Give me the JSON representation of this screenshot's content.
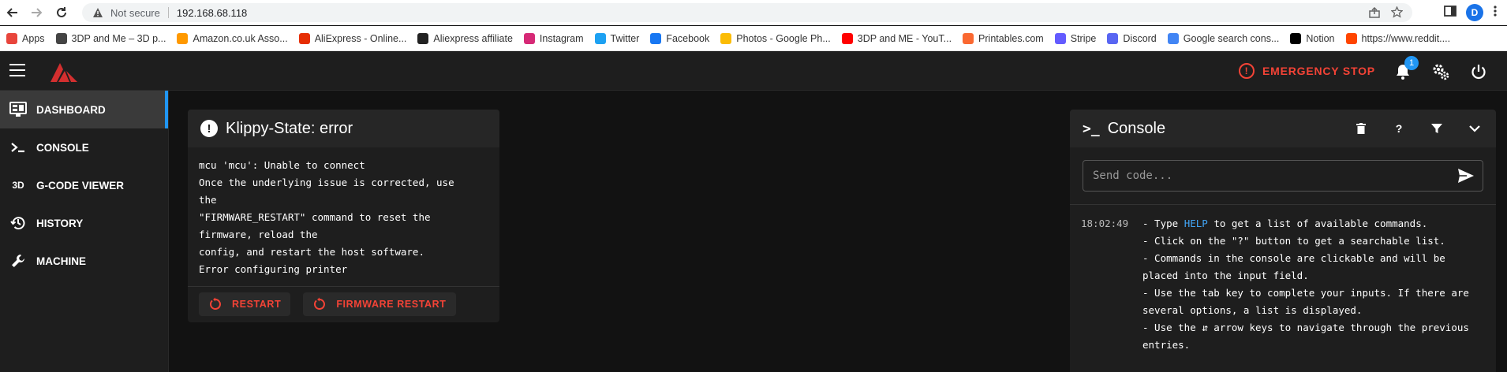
{
  "browser": {
    "security_label": "Not secure",
    "url": "192.168.68.118",
    "profile_initial": "D",
    "bookmarks": [
      {
        "label": "Apps",
        "icon": "apps-grid-icon",
        "color": "#e8453c"
      },
      {
        "label": "3DP and Me – 3D p...",
        "icon": "site-icon",
        "color": "#444444"
      },
      {
        "label": "Amazon.co.uk Asso...",
        "icon": "amazon-icon",
        "color": "#ff9900"
      },
      {
        "label": "AliExpress - Online...",
        "icon": "aliexpress-icon",
        "color": "#e62e04"
      },
      {
        "label": "Aliexpress affiliate",
        "icon": "globe-icon",
        "color": "#222222"
      },
      {
        "label": "Instagram",
        "icon": "instagram-icon",
        "color": "#d62976"
      },
      {
        "label": "Twitter",
        "icon": "twitter-icon",
        "color": "#1da1f2"
      },
      {
        "label": "Facebook",
        "icon": "facebook-icon",
        "color": "#1877f2"
      },
      {
        "label": "Photos - Google Ph...",
        "icon": "google-photos-icon",
        "color": "#fbbc05"
      },
      {
        "label": "3DP and ME - YouT...",
        "icon": "youtube-icon",
        "color": "#ff0000"
      },
      {
        "label": "Printables.com",
        "icon": "printables-icon",
        "color": "#fa6831"
      },
      {
        "label": "Stripe",
        "icon": "stripe-icon",
        "color": "#635bff"
      },
      {
        "label": "Discord",
        "icon": "discord-icon",
        "color": "#5865f2"
      },
      {
        "label": "Google search cons...",
        "icon": "search-console-icon",
        "color": "#4285f4"
      },
      {
        "label": "Notion",
        "icon": "notion-icon",
        "color": "#000000"
      },
      {
        "label": "https://www.reddit....",
        "icon": "reddit-icon",
        "color": "#ff4500"
      }
    ]
  },
  "appbar": {
    "emergency_stop_label": "EMERGENCY STOP",
    "notification_count": "1",
    "accent_color": "#f44336"
  },
  "sidebar": {
    "items": [
      {
        "label": "DASHBOARD",
        "icon": "monitor-dashboard-icon",
        "active": true
      },
      {
        "label": "CONSOLE",
        "icon": "console-icon",
        "active": false
      },
      {
        "label": "G-CODE VIEWER",
        "icon": "3d-icon",
        "icon_text": "3D",
        "active": false
      },
      {
        "label": "HISTORY",
        "icon": "history-icon",
        "active": false
      },
      {
        "label": "MACHINE",
        "icon": "wrench-icon",
        "active": false
      }
    ]
  },
  "klippy": {
    "title": "Klippy-State: error",
    "message": "mcu 'mcu': Unable to connect\nOnce the underlying issue is corrected, use\nthe\n\"FIRMWARE_RESTART\" command to reset the\nfirmware, reload the\nconfig, and restart the host software.\nError configuring printer",
    "restart_label": "RESTART",
    "firmware_restart_label": "FIRMWARE RESTART"
  },
  "console": {
    "title": "Console",
    "input_placeholder": "Send code...",
    "log_time": "18:02:49",
    "log_pre_link": "- Type ",
    "log_link": "HELP",
    "log_post_link": " to get a list of available commands.\n- Click on the \"?\" button to get a searchable list.\n- Commands in the console are clickable and will be placed into the input field.\n- Use the tab key to complete your inputs. If there are several options, a list is displayed.\n- Use the ⇵ arrow keys to navigate through the previous entries."
  }
}
